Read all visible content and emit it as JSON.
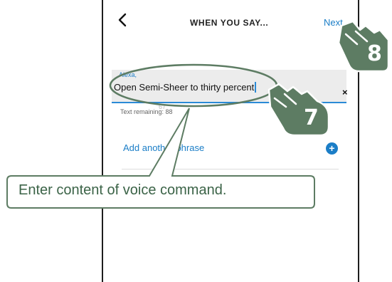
{
  "header": {
    "back_icon": "chevron-left-icon",
    "title": "WHEN YOU SAY...",
    "next_label": "Next"
  },
  "phrase_input": {
    "prefix": "Alexa,",
    "value": "Open Semi-Sheer to thirty percent",
    "clear_icon": "close-icon",
    "clear_label": "×",
    "text_remaining": "Text remaining: 88",
    "ghost_count": "67"
  },
  "add_phrase": {
    "label": "Add another phrase",
    "plus_icon": "plus-circle-icon",
    "plus_label": "+"
  },
  "annotation": {
    "callout": "Enter content of voice command.",
    "step_input": "7",
    "step_next": "8",
    "accent_color": "#5d7c63"
  }
}
